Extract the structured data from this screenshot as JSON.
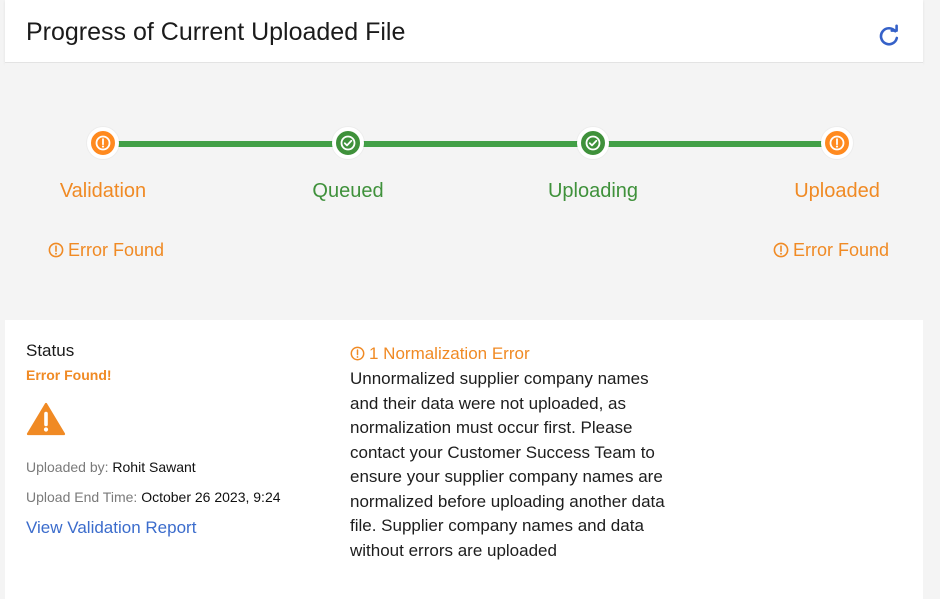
{
  "header": {
    "title": "Progress of Current Uploaded File",
    "refresh_icon": "refresh-icon"
  },
  "progress": {
    "steps": [
      {
        "label": "Validation",
        "state": "error",
        "status_text": "Error Found",
        "icon": "alert-circle-icon"
      },
      {
        "label": "Queued",
        "state": "complete",
        "status_text": "",
        "icon": "check-circle-icon"
      },
      {
        "label": "Uploading",
        "state": "complete",
        "status_text": "",
        "icon": "check-circle-icon"
      },
      {
        "label": "Uploaded",
        "state": "error",
        "status_text": "Error Found",
        "icon": "alert-circle-icon"
      }
    ]
  },
  "status": {
    "heading": "Status",
    "value": "Error Found!",
    "icon": "warning-triangle-icon",
    "uploaded_by_label": "Uploaded by:",
    "uploaded_by": "Rohit Sawant",
    "end_time_label": "Upload End Time:",
    "end_time": "October 26 2023, 9:24",
    "report_link": "View Validation Report"
  },
  "normalization": {
    "title": "1 Normalization Error",
    "message": "Unnormalized supplier company names and their data were not uploaded, as normalization must occur first. Please contact your Customer Success Team to ensure your supplier company names are normalized before uploading another data file. Supplier company names and data without errors are uploaded"
  },
  "colors": {
    "error": "#F08A24",
    "success": "#3F913B",
    "link": "#3B6CCC",
    "panel_background": "#F4F4F4"
  }
}
